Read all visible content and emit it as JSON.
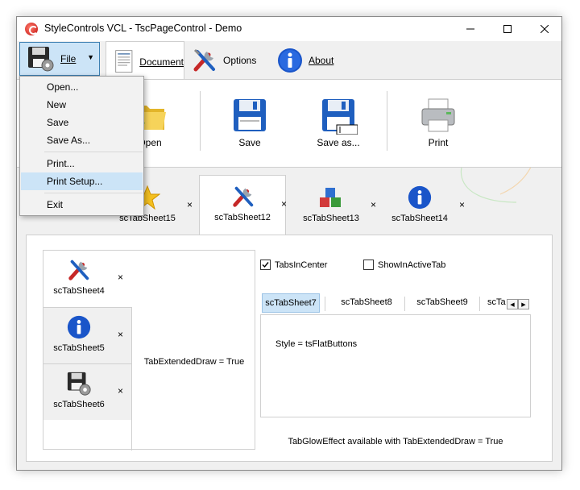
{
  "window": {
    "title": "StyleControls VCL - TscPageControl - Demo"
  },
  "ribbon": {
    "file_label": "File",
    "tabs": [
      {
        "label": "Document"
      },
      {
        "label": "Options"
      },
      {
        "label": "About"
      }
    ]
  },
  "toolbar": {
    "open_label": "Open",
    "save_label": "Save",
    "save_as_label": "Save as...",
    "print_label": "Print"
  },
  "file_menu": {
    "items": [
      "Open...",
      "New",
      "Save",
      "Save As...",
      "Print...",
      "Print Setup...",
      "Exit"
    ],
    "highlighted": "Print Setup..."
  },
  "top_tabs": [
    {
      "label": "scTabSheet15",
      "icon": "star-icon"
    },
    {
      "label": "scTabSheet12",
      "icon": "tools-icon",
      "active": true
    },
    {
      "label": "scTabSheet13",
      "icon": "cubes-icon"
    },
    {
      "label": "scTabSheet14",
      "icon": "info-icon"
    }
  ],
  "vertical_tabs": {
    "tabs": [
      {
        "label": "scTabSheet4",
        "icon": "tools-icon",
        "active": true
      },
      {
        "label": "scTabSheet5",
        "icon": "info-icon"
      },
      {
        "label": "scTabSheet6",
        "icon": "floppy-gear-icon"
      }
    ],
    "content": "TabExtendedDraw = True"
  },
  "options": {
    "tabs_in_center": {
      "label": "TabsInCenter",
      "checked": true
    },
    "show_in_active_tab": {
      "label": "ShowInActiveTab",
      "checked": false
    }
  },
  "horizontal_tabs": {
    "tabs": [
      "scTabSheet7",
      "scTabSheet8",
      "scTabSheet9",
      "scTa"
    ],
    "content": "Style = tsFlatButtons"
  },
  "footer_note": "TabGlowEffect available with TabExtendedDraw = True",
  "close_glyph": "×",
  "colors": {
    "accent": "#cce4f7",
    "accent_border": "#3c7fb1",
    "window_bg": "#f0f0f0"
  }
}
